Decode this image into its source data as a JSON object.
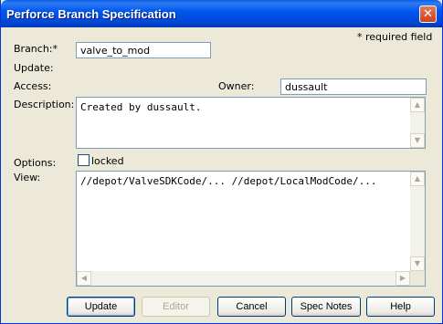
{
  "window": {
    "title": "Perforce Branch Specification",
    "close_glyph": "✕"
  },
  "required_note": "* required field",
  "labels": {
    "branch": "Branch:*",
    "update": "Update:",
    "access": "Access:",
    "owner": "Owner:",
    "description": "Description:",
    "options": "Options:",
    "view": "View:"
  },
  "fields": {
    "branch": "valve_to_mod",
    "owner": "dussault",
    "description": "Created by dussault.",
    "view": "//depot/ValveSDKCode/... //depot/LocalModCode/..."
  },
  "options": {
    "locked_label": "locked",
    "locked_checked": false
  },
  "buttons": {
    "update": "Update",
    "editor": "Editor",
    "cancel": "Cancel",
    "spec_notes": "Spec Notes",
    "help": "Help"
  },
  "scroll_glyphs": {
    "up": "▲",
    "down": "▼",
    "left": "◀",
    "right": "▶"
  },
  "colors": {
    "titlebar": "#0058EE",
    "dialog_bg": "#ECE9D8",
    "close": "#C8411D"
  }
}
